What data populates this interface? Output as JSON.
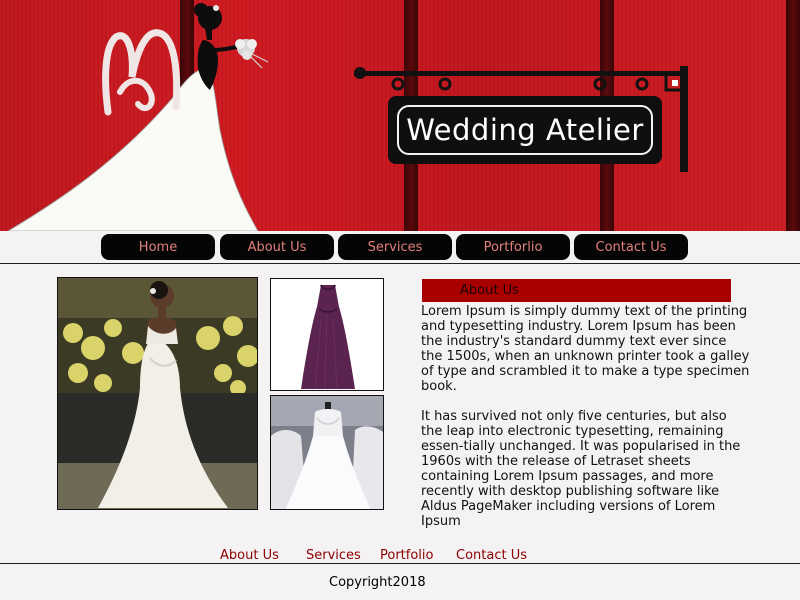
{
  "header": {
    "title": "Wedding Atelier"
  },
  "nav": {
    "items": [
      {
        "label": "Home"
      },
      {
        "label": "About Us"
      },
      {
        "label": "Services"
      },
      {
        "label": "Portforlio"
      },
      {
        "label": "Contact Us"
      }
    ]
  },
  "about": {
    "heading": "About Us",
    "paragraph1": "Lorem Ipsum is simply dummy text of the printing and typesetting industry. Lorem Ipsum has been the industry's standard dummy text ever since the 1500s, when an unknown printer took a galley of type and scrambled it to make a type specimen book.",
    "paragraph2": "It has survived not only five centuries, but also the leap into electronic typesetting, remaining essen-tially unchanged. It was popularised in the 1960s with the release of Letraset sheets containing Lorem Ipsum passages, and more recently with desktop publishing software like Aldus PageMaker including versions of Lorem Ipsum"
  },
  "footer": {
    "links": [
      {
        "label": "About Us"
      },
      {
        "label": "Services"
      },
      {
        "label": "Portfolio"
      },
      {
        "label": "Contact Us"
      }
    ],
    "copyright": "Copyright2018"
  },
  "colors": {
    "header_red": "#c8141b",
    "nav_button_bg": "#050505",
    "nav_button_text": "#e2807a",
    "about_bar": "#a80000",
    "footer_link": "#8b0000",
    "page_bg": "#f4f2f2"
  }
}
